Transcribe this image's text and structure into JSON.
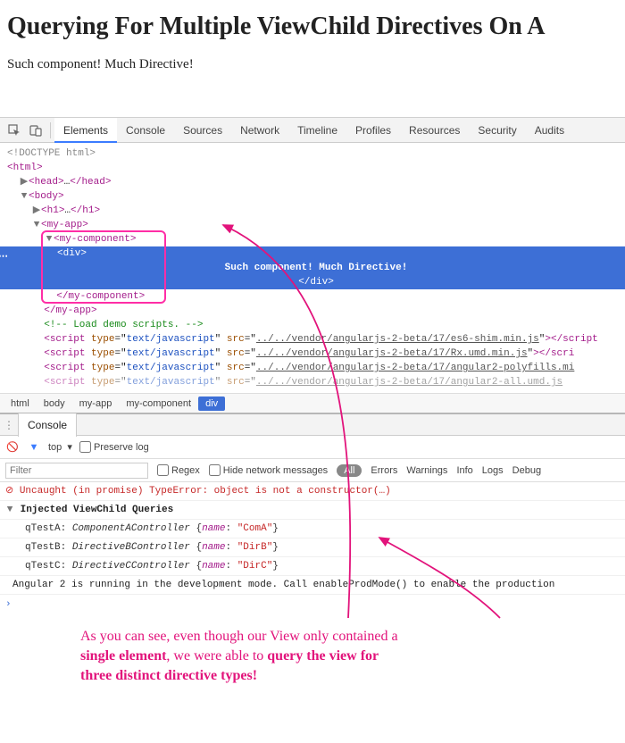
{
  "page": {
    "title": "Querying For Multiple ViewChild Directives On A",
    "subtitle": "Such component! Much Directive!"
  },
  "tabs": {
    "elements": "Elements",
    "console": "Console",
    "sources": "Sources",
    "network": "Network",
    "timeline": "Timeline",
    "profiles": "Profiles",
    "resources": "Resources",
    "security": "Security",
    "audits": "Audits"
  },
  "dom": {
    "doctype": "<!DOCTYPE html>",
    "html_open": "html",
    "head": "head",
    "body": "body",
    "h1": "h1",
    "myapp": "my-app",
    "mycomponent": "my-component",
    "div": "div",
    "selected_text": "Such component! Much Directive!",
    "div_close": "/div",
    "mycomponent_close": "/my-component",
    "myapp_close": "/my-app",
    "comment": "<!-- Load demo scripts. -->",
    "script_label": "script",
    "type_attr": "type",
    "type_val": "text/javascript",
    "src_attr": "src",
    "srcs": [
      "../../vendor/angularjs-2-beta/17/es6-shim.min.js",
      "../../vendor/angularjs-2-beta/17/Rx.umd.min.js",
      "../../vendor/angularjs-2-beta/17/angular2-polyfills.mi",
      "../../vendor/angularjs-2-beta/17/angular2-all.umd.js"
    ],
    "script_close": "/script",
    "script_close_trunc": "/scri"
  },
  "crumbs": [
    "html",
    "body",
    "my-app",
    "my-component",
    "div"
  ],
  "drawer": {
    "tab": "Console",
    "context": "top",
    "preserve": "Preserve log",
    "filter_placeholder": "Filter",
    "regex": "Regex",
    "hide": "Hide network messages",
    "levels": {
      "all": "All",
      "errors": "Errors",
      "warnings": "Warnings",
      "info": "Info",
      "logs": "Logs",
      "debug": "Debug"
    }
  },
  "console": {
    "error": "Uncaught (in promise) TypeError: object is not a constructor(…)",
    "group": "Injected ViewChild Queries",
    "lines": [
      {
        "key": "qTestA:",
        "cls": "ComponentAController",
        "prop": "name",
        "val": "\"ComA\""
      },
      {
        "key": "qTestB:",
        "cls": "DirectiveBController",
        "prop": "name",
        "val": "\"DirB\""
      },
      {
        "key": "qTestC:",
        "cls": "DirectiveCController",
        "prop": "name",
        "val": "\"DirC\""
      }
    ],
    "footer": "Angular 2 is running in the development mode. Call enableProdMode() to enable the production"
  },
  "annotation": {
    "l1a": "As you can see, even though our View only contained a",
    "l2a": "single element",
    "l2b": ", we were able to ",
    "l2c": "query the view for",
    "l3a": "three distinct directive types!"
  }
}
